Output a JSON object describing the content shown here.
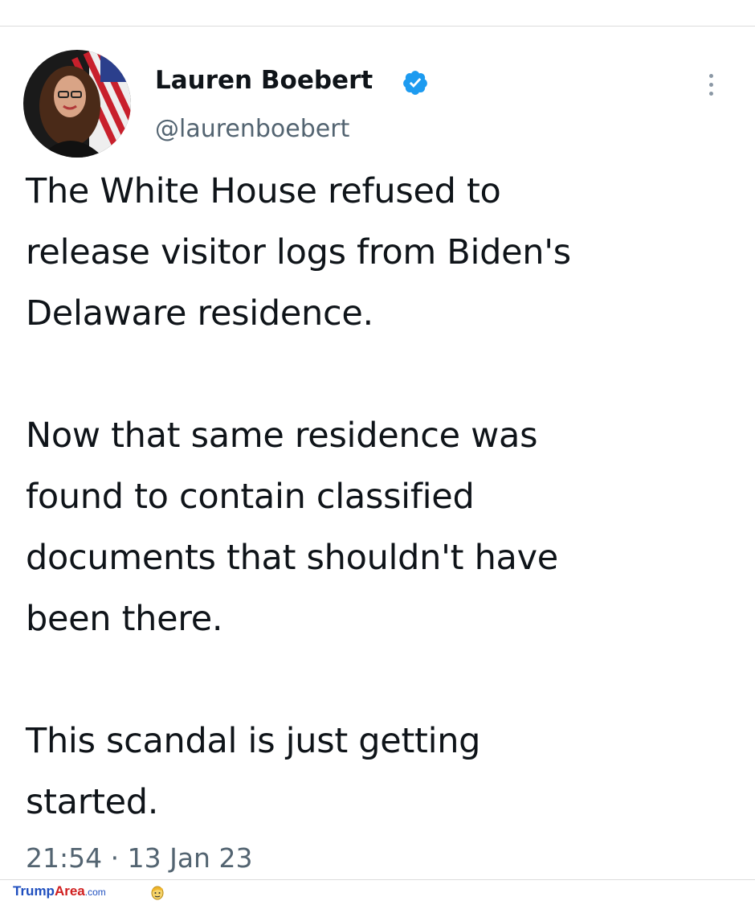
{
  "tweet": {
    "author": {
      "display_name": "Lauren Boebert",
      "handle": "@laurenboebert",
      "verified": true,
      "verified_color": "#1d9bf0"
    },
    "text_paragraphs": [
      "The White House refused to\nrelease visitor logs from Biden's\nDelaware residence.",
      "Now that same residence was\nfound to contain classified\ndocuments that shouldn't have\nbeen there.",
      "This scandal is just getting\nstarted."
    ],
    "time": "21:54",
    "separator": "·",
    "date": "13 Jan 23",
    "icons": {
      "avatar": "profile-photo",
      "verified": "verified-badge-icon",
      "more": "more-options-icon"
    }
  },
  "watermark": {
    "brand_part1": "Trump",
    "brand_part2": "Area",
    "brand_suffix": ".com"
  }
}
